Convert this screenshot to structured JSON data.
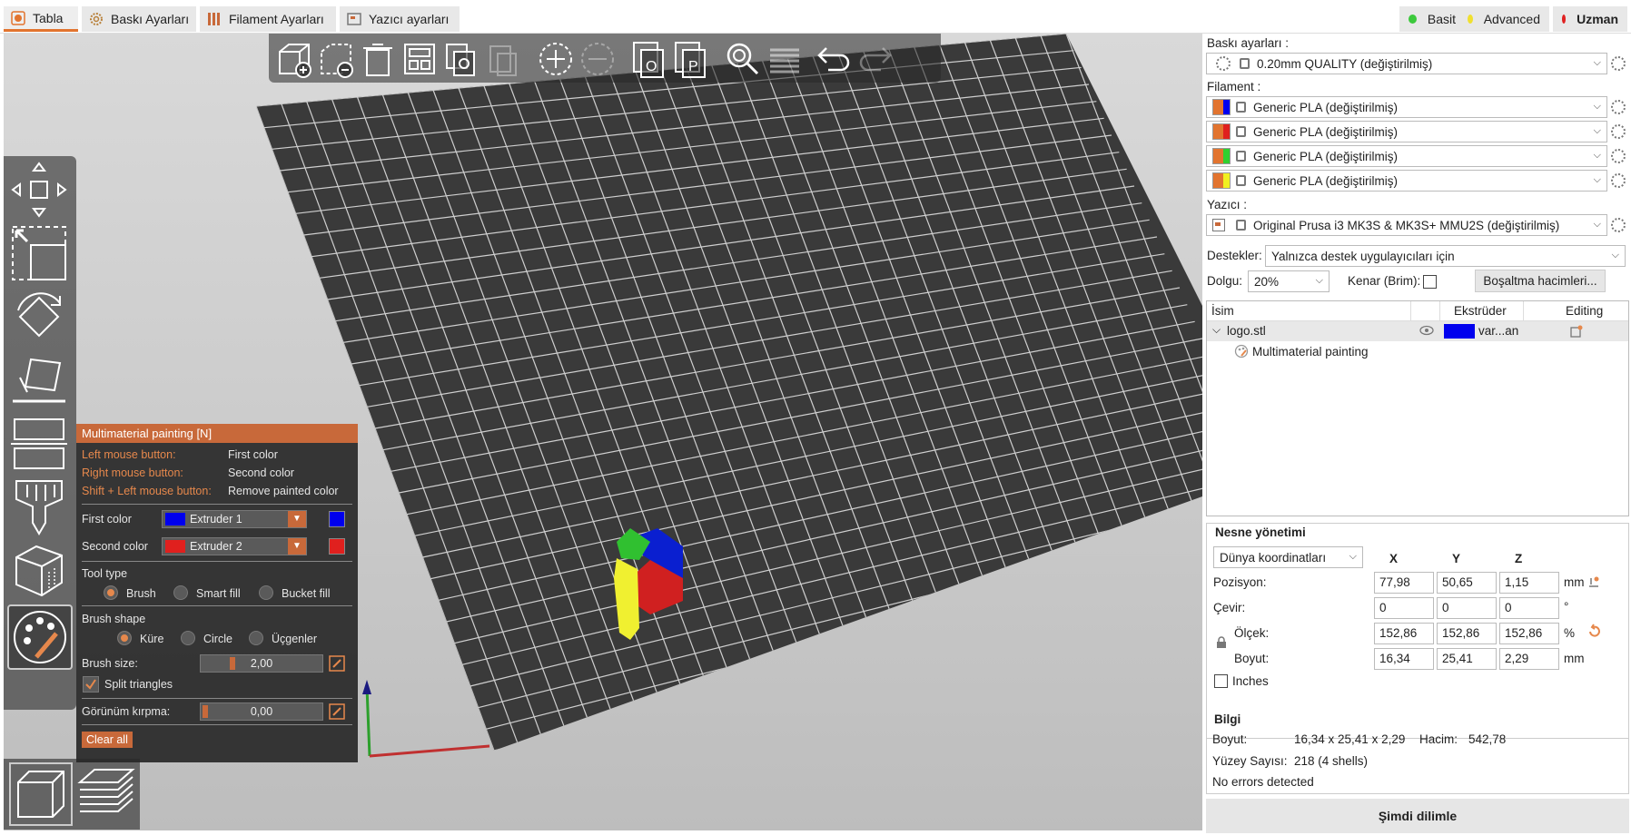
{
  "tabs": [
    {
      "label": "Tabla",
      "icon": "plater-icon"
    },
    {
      "label": "Baskı Ayarları",
      "icon": "print-settings-gear-icon"
    },
    {
      "label": "Filament Ayarları",
      "icon": "filament-spool-icon"
    },
    {
      "label": "Yazıcı ayarları",
      "icon": "printer-settings-icon"
    }
  ],
  "modes": [
    {
      "label": "Basit",
      "color": "#3cc93c"
    },
    {
      "label": "Advanced",
      "color": "#f0e030"
    },
    {
      "label": "Uzman",
      "color": "#e02020"
    }
  ],
  "toolbar_icons": [
    "add-icon",
    "delete-icon",
    "delete-all-icon",
    "arrange-icon",
    "copy-icon",
    "paste-icon",
    "add-instance-icon",
    "remove-instance-icon",
    "split-objects-icon",
    "split-parts-icon",
    "search-icon",
    "layers-editing-icon",
    "undo-icon",
    "redo-icon"
  ],
  "paint": {
    "title": "Multimaterial painting [N]",
    "left_mouse": "Left mouse button:",
    "left_mouse_val": "First color",
    "right_mouse": "Right mouse button:",
    "right_mouse_val": "Second color",
    "shift_left": "Shift + Left mouse button:",
    "shift_left_val": "Remove painted color",
    "first_color": "First color",
    "first_extruder": "Extruder 1",
    "first_color_hex": "#0000ee",
    "second_color": "Second color",
    "second_extruder": "Extruder 2",
    "second_color_hex": "#e0201e",
    "tool_type": "Tool type",
    "tool_brush": "Brush",
    "tool_smart": "Smart fill",
    "tool_bucket": "Bucket fill",
    "brush_shape": "Brush shape",
    "shape_sphere": "Küre",
    "shape_circle": "Circle",
    "shape_triangles": "Üçgenler",
    "brush_size": "Brush size:",
    "brush_size_val": "2,00",
    "split": "Split triangles",
    "clipping": "Görünüm kırpma:",
    "clipping_val": "0,00",
    "clear": "Clear all"
  },
  "right": {
    "print_settings_label": "Baskı ayarları :",
    "print_profile": "0.20mm QUALITY (değiştirilmiş)",
    "filament_label": "Filament :",
    "filaments": [
      {
        "name": "Generic PLA (değiştirilmiş)",
        "color": "#0000ee"
      },
      {
        "name": "Generic PLA (değiştirilmiş)",
        "color": "#e0201e"
      },
      {
        "name": "Generic PLA (değiştirilmiş)",
        "color": "#30d030"
      },
      {
        "name": "Generic PLA (değiştirilmiş)",
        "color": "#f0f020"
      }
    ],
    "printer_label": "Yazıcı :",
    "printer": "Original Prusa i3 MK3S & MK3S+ MMU2S (değiştirilmiş)",
    "supports_label": "Destekler:",
    "supports_val": "Yalnızca destek uygulayıcıları için",
    "infill_label": "Dolgu:",
    "infill_val": "20%",
    "brim_label": "Kenar (Brim):",
    "purge_button": "Boşaltma hacimleri...",
    "col_name": "İsim",
    "col_extruder": "Ekstrüder",
    "col_editing": "Editing",
    "object_name": "logo.stl",
    "object_extruder": "var...an",
    "object_extruder_color": "#0000ee",
    "modifier": "Multimaterial painting",
    "manip_title": "Nesne yönetimi",
    "coord_sel": "Dünya koordinatları",
    "x": "X",
    "y": "Y",
    "z": "Z",
    "position_label": "Pozisyon:",
    "pos": [
      "77,98",
      "50,65",
      "1,15"
    ],
    "pos_unit": "mm",
    "rotate_label": "Çevir:",
    "rot": [
      "0",
      "0",
      "0"
    ],
    "rot_unit": "°",
    "scale_label": "Ölçek:",
    "scale": [
      "152,86",
      "152,86",
      "152,86"
    ],
    "scale_unit": "%",
    "size_label": "Boyut:",
    "size": [
      "16,34",
      "25,41",
      "2,29"
    ],
    "size_unit": "mm",
    "inches": "Inches",
    "info_title": "Bilgi",
    "info_size_label": "Boyut:",
    "info_size_val": "16,34 x 25,41 x 2,29",
    "info_volume_label": "Hacim:",
    "info_volume_val": "542,78",
    "info_facets_label": "Yüzey Sayısı:",
    "info_facets_val": "218 (4 shells)",
    "info_errors": "No errors detected",
    "slice_button": "Şimdi dilimle"
  }
}
